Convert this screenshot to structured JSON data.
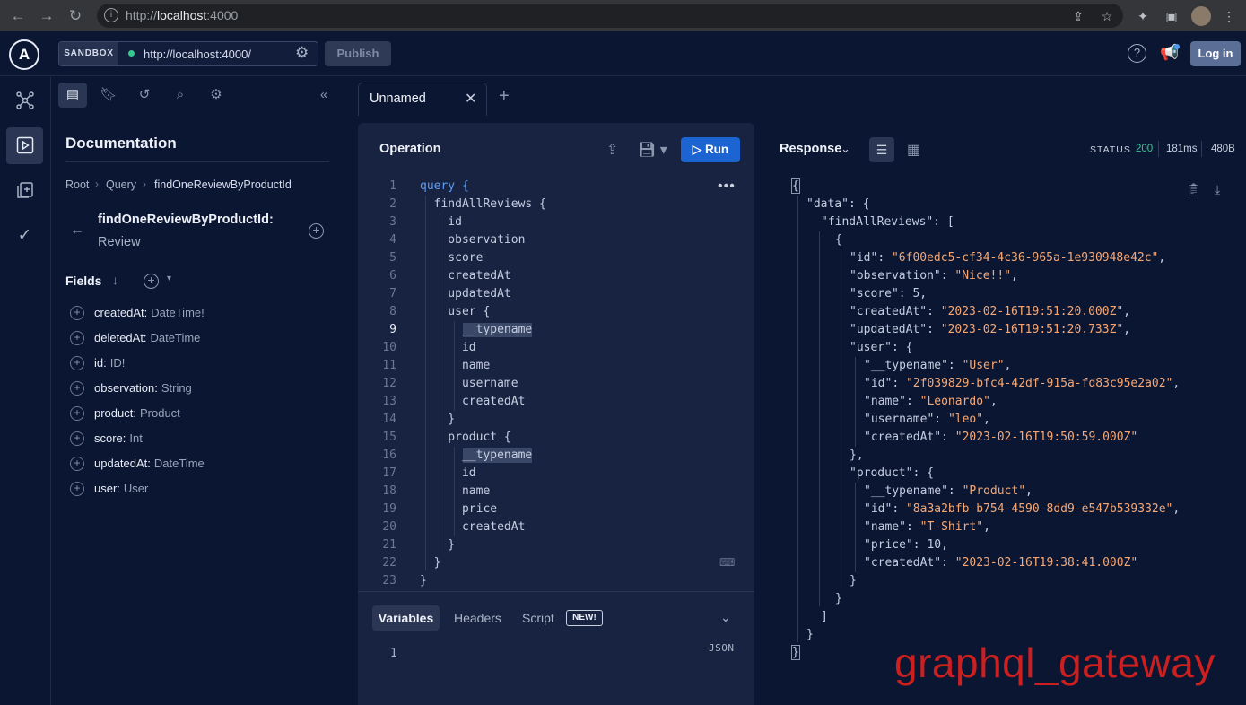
{
  "browser": {
    "url_prefix": "http://",
    "url_host": "localhost",
    "url_port": ":4000"
  },
  "header": {
    "sandbox_label": "SANDBOX",
    "endpoint": "http://localhost:4000/",
    "publish_label": "Publish",
    "login_label": "Log in",
    "help_label": "?"
  },
  "docs": {
    "title": "Documentation",
    "breadcrumb": [
      "Root",
      "Query",
      "findOneReviewByProductId"
    ],
    "field_name": "findOneReviewByProductId:",
    "field_type": "Review",
    "fields_heading": "Fields",
    "fields": [
      {
        "name": "createdAt:",
        "type": "DateTime!"
      },
      {
        "name": "deletedAt:",
        "type": "DateTime"
      },
      {
        "name": "id:",
        "type": "ID!"
      },
      {
        "name": "observation:",
        "type": "String"
      },
      {
        "name": "product:",
        "type": "Product"
      },
      {
        "name": "score:",
        "type": "Int"
      },
      {
        "name": "updatedAt:",
        "type": "DateTime"
      },
      {
        "name": "user:",
        "type": "User"
      }
    ]
  },
  "tabs": [
    {
      "label": "Unnamed"
    }
  ],
  "operation": {
    "title": "Operation",
    "run_label": "Run",
    "lines": [
      "query {",
      "  findAllReviews {",
      "    id",
      "    observation",
      "    score",
      "    createdAt",
      "    updatedAt",
      "    user {",
      "      __typename",
      "      id",
      "      name",
      "      username",
      "      createdAt",
      "    }",
      "    product {",
      "      __typename",
      "      id",
      "      name",
      "      price",
      "      createdAt",
      "    }",
      "  }",
      "}"
    ],
    "line_numbers": [
      "1",
      "2",
      "3",
      "4",
      "5",
      "6",
      "7",
      "8",
      "9",
      "10",
      "11",
      "12",
      "13",
      "14",
      "15",
      "16",
      "17",
      "18",
      "19",
      "20",
      "21",
      "22",
      "23"
    ]
  },
  "variables": {
    "tabs": [
      "Variables",
      "Headers",
      "Script"
    ],
    "new_badge": "NEW!",
    "format_label": "JSON",
    "line_number": "1"
  },
  "response": {
    "title": "Response",
    "status_label": "STATUS",
    "status_code": "200",
    "time": "181ms",
    "size": "480B",
    "lines": [
      {
        "indent": 0,
        "text": "{"
      },
      {
        "indent": 1,
        "key": "\"data\"",
        "rest": ": {"
      },
      {
        "indent": 2,
        "key": "\"findAllReviews\"",
        "rest": ": ["
      },
      {
        "indent": 3,
        "text": "{"
      },
      {
        "indent": 4,
        "key": "\"id\"",
        "str": "\"6f00edc5-cf34-4c36-965a-1e930948e42c\"",
        "tail": ","
      },
      {
        "indent": 4,
        "key": "\"observation\"",
        "str": "\"Nice!!\"",
        "tail": ","
      },
      {
        "indent": 4,
        "key": "\"score\"",
        "num": "5",
        "tail": ","
      },
      {
        "indent": 4,
        "key": "\"createdAt\"",
        "str": "\"2023-02-16T19:51:20.000Z\"",
        "tail": ","
      },
      {
        "indent": 4,
        "key": "\"updatedAt\"",
        "str": "\"2023-02-16T19:51:20.733Z\"",
        "tail": ","
      },
      {
        "indent": 4,
        "key": "\"user\"",
        "rest": ": {"
      },
      {
        "indent": 5,
        "key": "\"__typename\"",
        "str": "\"User\"",
        "tail": ","
      },
      {
        "indent": 5,
        "key": "\"id\"",
        "str": "\"2f039829-bfc4-42df-915a-fd83c95e2a02\"",
        "tail": ","
      },
      {
        "indent": 5,
        "key": "\"name\"",
        "str": "\"Leonardo\"",
        "tail": ","
      },
      {
        "indent": 5,
        "key": "\"username\"",
        "str": "\"leo\"",
        "tail": ","
      },
      {
        "indent": 5,
        "key": "\"createdAt\"",
        "str": "\"2023-02-16T19:50:59.000Z\"",
        "tail": ""
      },
      {
        "indent": 4,
        "text": "},"
      },
      {
        "indent": 4,
        "key": "\"product\"",
        "rest": ": {"
      },
      {
        "indent": 5,
        "key": "\"__typename\"",
        "str": "\"Product\"",
        "tail": ","
      },
      {
        "indent": 5,
        "key": "\"id\"",
        "str": "\"8a3a2bfb-b754-4590-8dd9-e547b539332e\"",
        "tail": ","
      },
      {
        "indent": 5,
        "key": "\"name\"",
        "str": "\"T-Shirt\"",
        "tail": ","
      },
      {
        "indent": 5,
        "key": "\"price\"",
        "num": "10",
        "tail": ","
      },
      {
        "indent": 5,
        "key": "\"createdAt\"",
        "str": "\"2023-02-16T19:38:41.000Z\"",
        "tail": ""
      },
      {
        "indent": 4,
        "text": "}"
      },
      {
        "indent": 3,
        "text": "}"
      },
      {
        "indent": 2,
        "text": "]"
      },
      {
        "indent": 1,
        "text": "}"
      },
      {
        "indent": 0,
        "text": "}"
      }
    ]
  },
  "watermark": "graphql_gateway",
  "colors": {
    "background": "#0b1633",
    "panel": "#182341",
    "run_button": "#1b64d1",
    "status_ok": "#36c98e",
    "json_string": "#f5a875",
    "keyword": "#5b9cf2",
    "watermark": "#cc1f1f"
  }
}
